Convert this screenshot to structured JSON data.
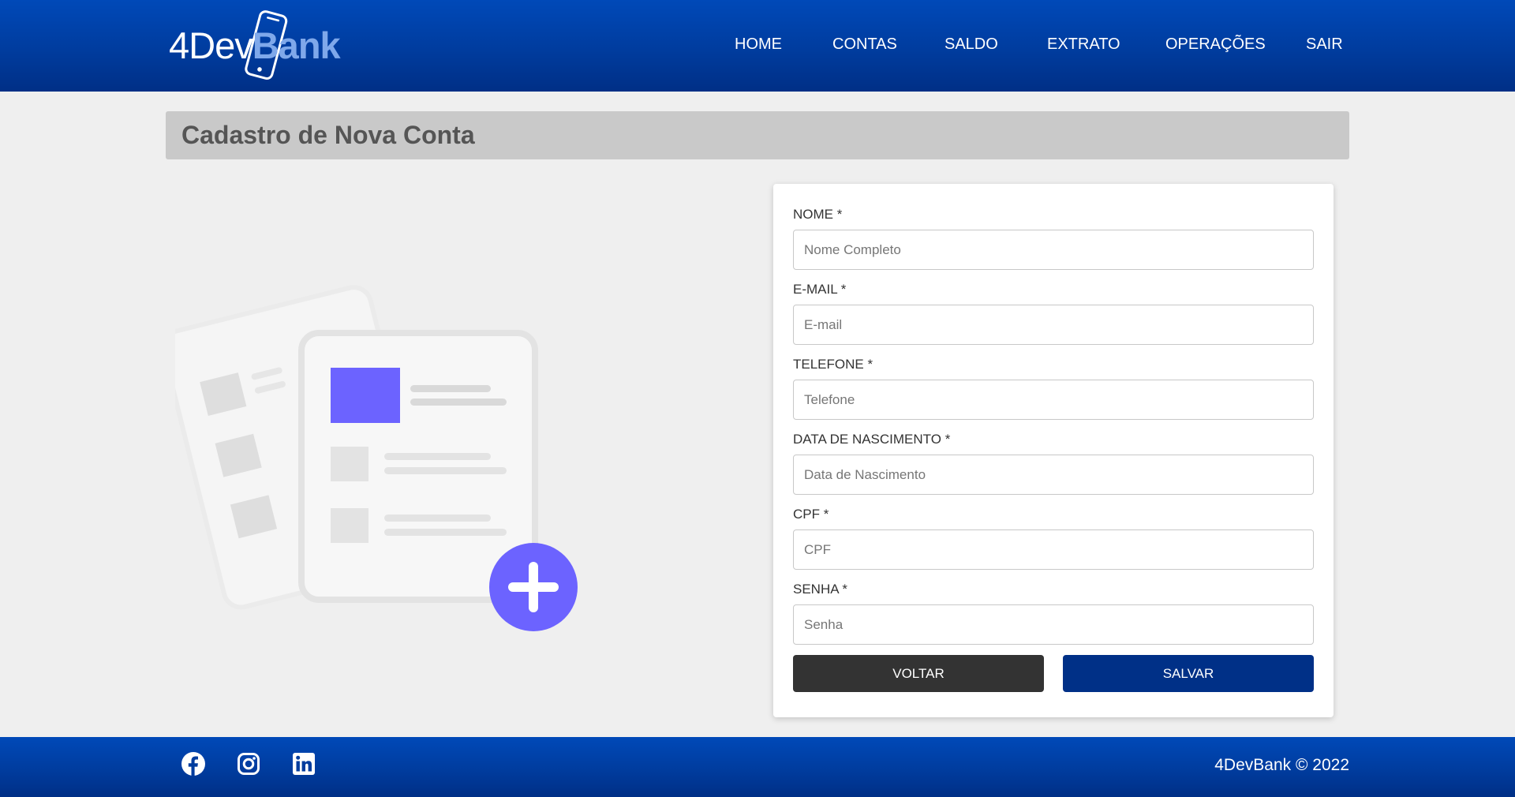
{
  "brand": {
    "logo_part1": "4Dev",
    "logo_part2": "Bank"
  },
  "nav": {
    "items": [
      {
        "label": "HOME"
      },
      {
        "label": "CONTAS"
      },
      {
        "label": "SALDO"
      },
      {
        "label": "EXTRATO"
      },
      {
        "label": "OPERAÇÕES"
      },
      {
        "label": "SAIR"
      }
    ]
  },
  "page": {
    "title": "Cadastro de Nova Conta"
  },
  "form": {
    "fields": [
      {
        "label": "NOME *",
        "placeholder": "Nome Completo",
        "value": ""
      },
      {
        "label": "E-MAIL *",
        "placeholder": "E-mail",
        "value": ""
      },
      {
        "label": "TELEFONE *",
        "placeholder": "Telefone",
        "value": ""
      },
      {
        "label": "DATA DE NASCIMENTO *",
        "placeholder": "Data de Nascimento",
        "value": ""
      },
      {
        "label": "CPF *",
        "placeholder": "CPF",
        "value": ""
      },
      {
        "label": "SENHA *",
        "placeholder": "Senha",
        "value": ""
      }
    ],
    "back_label": "VOLTAR",
    "save_label": "SALVAR"
  },
  "footer": {
    "social": [
      {
        "icon": "facebook-icon"
      },
      {
        "icon": "instagram-icon"
      },
      {
        "icon": "linkedin-icon"
      }
    ],
    "copyright": "4DevBank © 2022"
  },
  "colors": {
    "header_blue": "#0049b8",
    "save_button": "#003087",
    "back_button": "#333333",
    "illustration_accent": "#6c63ff"
  }
}
